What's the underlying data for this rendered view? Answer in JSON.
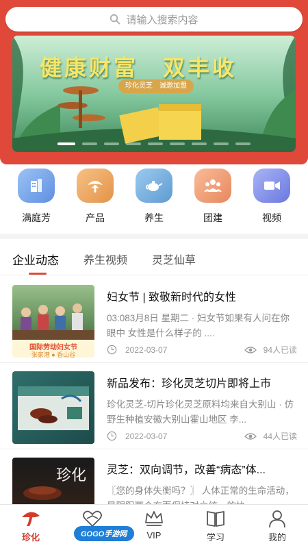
{
  "search": {
    "placeholder": "请输入搜索内容"
  },
  "banner": {
    "title": "健康财富　双丰收",
    "tag": "珍化灵芝　诚邀加盟",
    "dot_count": 9,
    "active_dot": 1
  },
  "categories": [
    {
      "label": "满庭芳",
      "icon": "building-icon",
      "color": "#6f9ee6"
    },
    {
      "label": "产品",
      "icon": "mushroom-icon",
      "color": "#e8a05a"
    },
    {
      "label": "养生",
      "icon": "teapot-icon",
      "color": "#6aa7d6"
    },
    {
      "label": "团建",
      "icon": "group-icon",
      "color": "#ee9a6c"
    },
    {
      "label": "视频",
      "icon": "video-icon",
      "color": "#7f8de8"
    }
  ],
  "tabs": [
    "企业动态",
    "养生视频",
    "灵芝仙草"
  ],
  "news": [
    {
      "title": "妇女节 | 致敬新时代的女性",
      "desc": "03:083月8日 星期二 · 妇女节如果有人问在你眼中 女性是什么样子的 ....",
      "date": "2022-03-07",
      "views": "94人已读",
      "thumb_caption_1": "国际劳动妇女节",
      "thumb_caption_2": "张家港 ● 香山谷"
    },
    {
      "title": "新品发布：珍化灵芝切片即将上市",
      "desc": "珍化灵芝-切片珍化灵芝原料均来自大别山 · 仿野生种植安徽大别山霍山地区 李...",
      "date": "2022-03-07",
      "views": "44人已读"
    },
    {
      "title": "灵芝：双向调节，改善“病态”体...",
      "desc": "〖您的身体失衡吗？〗 人体正常的生命活动，是阴阳两个方面保持对立统一的协",
      "thumb_caption_1": "珍化"
    }
  ],
  "bottom_nav": [
    {
      "label": "珍化",
      "icon": "lingzhi-icon",
      "active": true
    },
    {
      "label": "",
      "icon": "heart-hands-icon",
      "active": false
    },
    {
      "label": "VIP",
      "icon": "crown-icon",
      "active": false
    },
    {
      "label": "学习",
      "icon": "book-icon",
      "active": false
    },
    {
      "label": "我的",
      "icon": "user-icon",
      "active": false
    }
  ],
  "watermark": "GOGO手游网",
  "colors": {
    "brand": "#e0483a",
    "active_nav": "#d33b2e"
  }
}
